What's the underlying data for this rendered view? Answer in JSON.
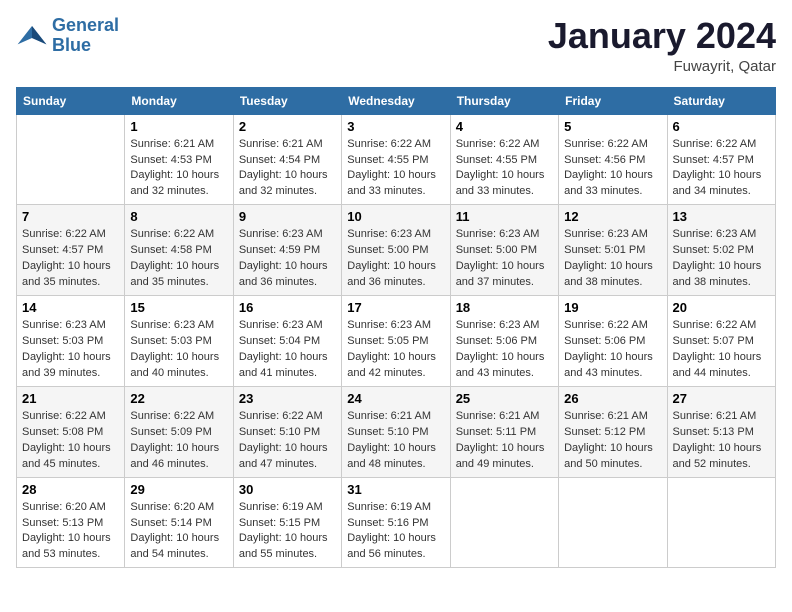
{
  "header": {
    "logo_line1": "General",
    "logo_line2": "Blue",
    "month_title": "January 2024",
    "location": "Fuwayrit, Qatar"
  },
  "days_of_week": [
    "Sunday",
    "Monday",
    "Tuesday",
    "Wednesday",
    "Thursday",
    "Friday",
    "Saturday"
  ],
  "weeks": [
    [
      {
        "day": "",
        "info": ""
      },
      {
        "day": "1",
        "info": "Sunrise: 6:21 AM\nSunset: 4:53 PM\nDaylight: 10 hours\nand 32 minutes."
      },
      {
        "day": "2",
        "info": "Sunrise: 6:21 AM\nSunset: 4:54 PM\nDaylight: 10 hours\nand 32 minutes."
      },
      {
        "day": "3",
        "info": "Sunrise: 6:22 AM\nSunset: 4:55 PM\nDaylight: 10 hours\nand 33 minutes."
      },
      {
        "day": "4",
        "info": "Sunrise: 6:22 AM\nSunset: 4:55 PM\nDaylight: 10 hours\nand 33 minutes."
      },
      {
        "day": "5",
        "info": "Sunrise: 6:22 AM\nSunset: 4:56 PM\nDaylight: 10 hours\nand 33 minutes."
      },
      {
        "day": "6",
        "info": "Sunrise: 6:22 AM\nSunset: 4:57 PM\nDaylight: 10 hours\nand 34 minutes."
      }
    ],
    [
      {
        "day": "7",
        "info": "Sunrise: 6:22 AM\nSunset: 4:57 PM\nDaylight: 10 hours\nand 35 minutes."
      },
      {
        "day": "8",
        "info": "Sunrise: 6:22 AM\nSunset: 4:58 PM\nDaylight: 10 hours\nand 35 minutes."
      },
      {
        "day": "9",
        "info": "Sunrise: 6:23 AM\nSunset: 4:59 PM\nDaylight: 10 hours\nand 36 minutes."
      },
      {
        "day": "10",
        "info": "Sunrise: 6:23 AM\nSunset: 5:00 PM\nDaylight: 10 hours\nand 36 minutes."
      },
      {
        "day": "11",
        "info": "Sunrise: 6:23 AM\nSunset: 5:00 PM\nDaylight: 10 hours\nand 37 minutes."
      },
      {
        "day": "12",
        "info": "Sunrise: 6:23 AM\nSunset: 5:01 PM\nDaylight: 10 hours\nand 38 minutes."
      },
      {
        "day": "13",
        "info": "Sunrise: 6:23 AM\nSunset: 5:02 PM\nDaylight: 10 hours\nand 38 minutes."
      }
    ],
    [
      {
        "day": "14",
        "info": "Sunrise: 6:23 AM\nSunset: 5:03 PM\nDaylight: 10 hours\nand 39 minutes."
      },
      {
        "day": "15",
        "info": "Sunrise: 6:23 AM\nSunset: 5:03 PM\nDaylight: 10 hours\nand 40 minutes."
      },
      {
        "day": "16",
        "info": "Sunrise: 6:23 AM\nSunset: 5:04 PM\nDaylight: 10 hours\nand 41 minutes."
      },
      {
        "day": "17",
        "info": "Sunrise: 6:23 AM\nSunset: 5:05 PM\nDaylight: 10 hours\nand 42 minutes."
      },
      {
        "day": "18",
        "info": "Sunrise: 6:23 AM\nSunset: 5:06 PM\nDaylight: 10 hours\nand 43 minutes."
      },
      {
        "day": "19",
        "info": "Sunrise: 6:22 AM\nSunset: 5:06 PM\nDaylight: 10 hours\nand 43 minutes."
      },
      {
        "day": "20",
        "info": "Sunrise: 6:22 AM\nSunset: 5:07 PM\nDaylight: 10 hours\nand 44 minutes."
      }
    ],
    [
      {
        "day": "21",
        "info": "Sunrise: 6:22 AM\nSunset: 5:08 PM\nDaylight: 10 hours\nand 45 minutes."
      },
      {
        "day": "22",
        "info": "Sunrise: 6:22 AM\nSunset: 5:09 PM\nDaylight: 10 hours\nand 46 minutes."
      },
      {
        "day": "23",
        "info": "Sunrise: 6:22 AM\nSunset: 5:10 PM\nDaylight: 10 hours\nand 47 minutes."
      },
      {
        "day": "24",
        "info": "Sunrise: 6:21 AM\nSunset: 5:10 PM\nDaylight: 10 hours\nand 48 minutes."
      },
      {
        "day": "25",
        "info": "Sunrise: 6:21 AM\nSunset: 5:11 PM\nDaylight: 10 hours\nand 49 minutes."
      },
      {
        "day": "26",
        "info": "Sunrise: 6:21 AM\nSunset: 5:12 PM\nDaylight: 10 hours\nand 50 minutes."
      },
      {
        "day": "27",
        "info": "Sunrise: 6:21 AM\nSunset: 5:13 PM\nDaylight: 10 hours\nand 52 minutes."
      }
    ],
    [
      {
        "day": "28",
        "info": "Sunrise: 6:20 AM\nSunset: 5:13 PM\nDaylight: 10 hours\nand 53 minutes."
      },
      {
        "day": "29",
        "info": "Sunrise: 6:20 AM\nSunset: 5:14 PM\nDaylight: 10 hours\nand 54 minutes."
      },
      {
        "day": "30",
        "info": "Sunrise: 6:19 AM\nSunset: 5:15 PM\nDaylight: 10 hours\nand 55 minutes."
      },
      {
        "day": "31",
        "info": "Sunrise: 6:19 AM\nSunset: 5:16 PM\nDaylight: 10 hours\nand 56 minutes."
      },
      {
        "day": "",
        "info": ""
      },
      {
        "day": "",
        "info": ""
      },
      {
        "day": "",
        "info": ""
      }
    ]
  ]
}
